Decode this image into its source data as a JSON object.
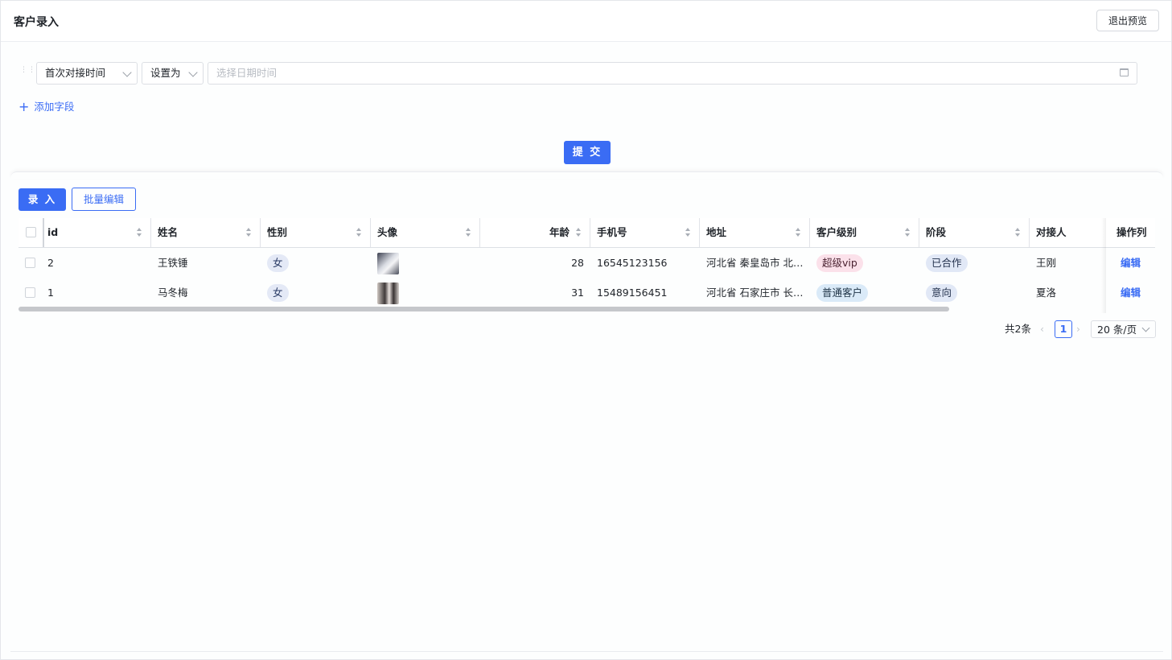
{
  "header": {
    "title": "客户录入",
    "exit_preview": "退出预览"
  },
  "filter": {
    "field_select": "首次对接时间",
    "operator_select": "设置为",
    "date_placeholder": "选择日期时间",
    "add_field": "添加字段",
    "submit": "提 交"
  },
  "toolbar": {
    "record": "录 入",
    "batch_edit": "批量编辑"
  },
  "table": {
    "columns": [
      "id",
      "姓名",
      "性别",
      "头像",
      "年龄",
      "手机号",
      "地址",
      "客户级别",
      "阶段",
      "对接人",
      "操作列"
    ],
    "rows": [
      {
        "id": "2",
        "name": "王铁锤",
        "gender": "女",
        "avatar": "avatar-image",
        "age": "28",
        "phone": "16545123156",
        "address": "河北省 秦皇岛市 北…",
        "level": "超级vip",
        "stage": "已合作",
        "contact": "王刚",
        "action": "编辑"
      },
      {
        "id": "1",
        "name": "马冬梅",
        "gender": "女",
        "avatar": "avatar-image",
        "age": "31",
        "phone": "15489156451",
        "address": "河北省 石家庄市 长…",
        "level": "普通客户",
        "stage": "意向",
        "contact": "夏洛",
        "action": "编辑"
      }
    ]
  },
  "pagination": {
    "total": "共2条",
    "current": "1",
    "page_size": "20 条/页"
  },
  "colors": {
    "primary": "#3a6cf4",
    "vip_tag": "#fbe1ea",
    "normal_tag": "#daeaf8"
  }
}
